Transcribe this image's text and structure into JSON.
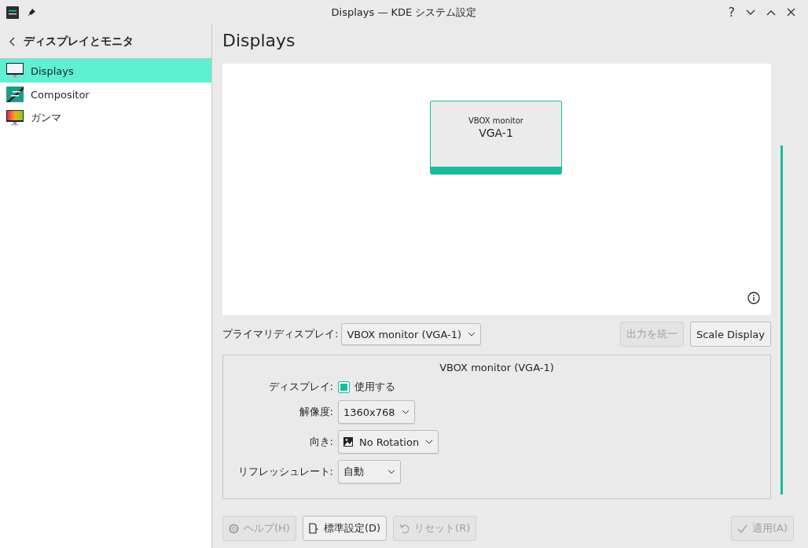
{
  "window": {
    "title": "Displays — KDE システム設定",
    "buttons": [
      "?"
    ]
  },
  "sidebar": {
    "title": "ディスプレイとモニタ",
    "items": [
      {
        "label": "Displays",
        "kind": "display",
        "selected": true
      },
      {
        "label": "Compositor",
        "kind": "compositor",
        "selected": false
      },
      {
        "label": "ガンマ",
        "kind": "gamma",
        "selected": false
      }
    ]
  },
  "page": {
    "title": "Displays"
  },
  "canvas": {
    "monitors": [
      {
        "name": "VBOX monitor",
        "output": "VGA-1",
        "selected": true
      }
    ]
  },
  "primary": {
    "label": "プライマリディスプレイ:",
    "value": "VBOX monitor (VGA-1)"
  },
  "top_buttons": [
    {
      "label": "出力を統一",
      "disabled": true
    },
    {
      "label": "Scale Display",
      "disabled": false
    }
  ],
  "output": {
    "title": "VBOX monitor (VGA-1)",
    "rows": [
      {
        "kind": "checkbox",
        "label": "ディスプレイ:",
        "value": "使用する",
        "checked": true
      },
      {
        "kind": "dropdown",
        "label": "解像度:",
        "value": "1360x768"
      },
      {
        "kind": "dropdown",
        "label": "向き:",
        "value": "No Rotation",
        "icon": true
      },
      {
        "kind": "dropdown",
        "label": "リフレッシュレート:",
        "value": "自動"
      }
    ]
  },
  "footer": [
    {
      "label": "ヘルプ(H)",
      "kind": "help",
      "disabled": true
    },
    {
      "label": "標準設定(D)",
      "kind": "defaults",
      "disabled": false
    },
    {
      "label": "リセット(R)",
      "kind": "reset",
      "disabled": true
    },
    {
      "label": "適用(A)",
      "kind": "apply",
      "disabled": true
    }
  ]
}
